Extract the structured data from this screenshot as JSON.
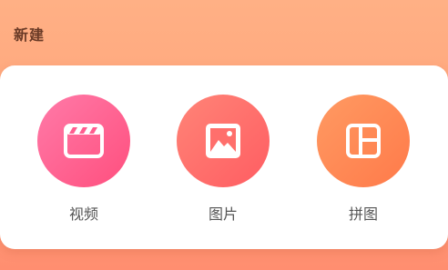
{
  "header": {
    "title": "新建"
  },
  "options": [
    {
      "label": "视频",
      "icon": "clapperboard-icon",
      "color": "#ff5d8f"
    },
    {
      "label": "图片",
      "icon": "image-icon",
      "color": "#ff6f6c"
    },
    {
      "label": "拼图",
      "icon": "collage-icon",
      "color": "#ff8a55"
    }
  ]
}
